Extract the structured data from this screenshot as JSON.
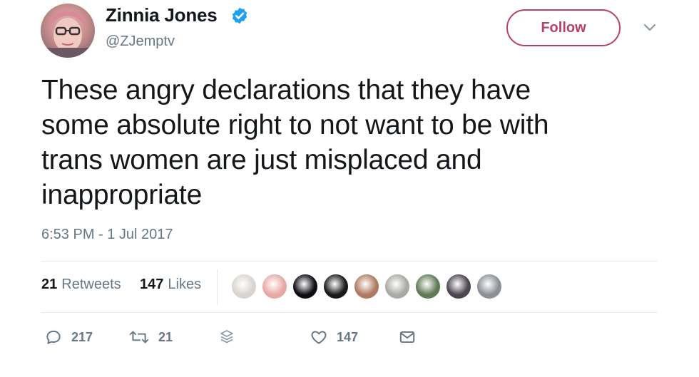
{
  "user": {
    "display_name": "Zinnia Jones",
    "handle": "@ZJemptv",
    "verified_icon": "verified-badge-icon",
    "avatar": "profile-avatar"
  },
  "header": {
    "follow_label": "Follow",
    "menu_icon": "chevron-down-icon",
    "accent_color": "#b8406d"
  },
  "tweet": {
    "lines": [
      "These angry declarations that they have",
      "some absolute right to not want to be with",
      "trans women are just misplaced and",
      "inappropriate"
    ],
    "timestamp": "6:53 PM - 1 Jul 2017"
  },
  "stats": {
    "retweets_count": "21",
    "retweets_label": "Retweets",
    "likes_count": "147",
    "likes_label": "Likes"
  },
  "likers": [
    {
      "name": "liker-avatar-1",
      "color": "#d9d4d0"
    },
    {
      "name": "liker-avatar-2",
      "color": "#e7a9a6"
    },
    {
      "name": "liker-avatar-3",
      "color": "#0d0d12"
    },
    {
      "name": "liker-avatar-4",
      "color": "#1a1a1a"
    },
    {
      "name": "liker-avatar-5",
      "color": "#b07a62"
    },
    {
      "name": "liker-avatar-6",
      "color": "#a8aaa5"
    },
    {
      "name": "liker-avatar-7",
      "color": "#5f7a55"
    },
    {
      "name": "liker-avatar-8",
      "color": "#4b4651"
    },
    {
      "name": "liker-avatar-9",
      "color": "#8c8f96"
    }
  ],
  "actions": {
    "reply_count": "217",
    "retweet_count": "21",
    "like_count": "147",
    "reply_icon": "reply-icon",
    "retweet_icon": "retweet-icon",
    "buffer_icon": "stack-layers-icon",
    "like_icon": "heart-icon",
    "dm_icon": "envelope-icon"
  }
}
